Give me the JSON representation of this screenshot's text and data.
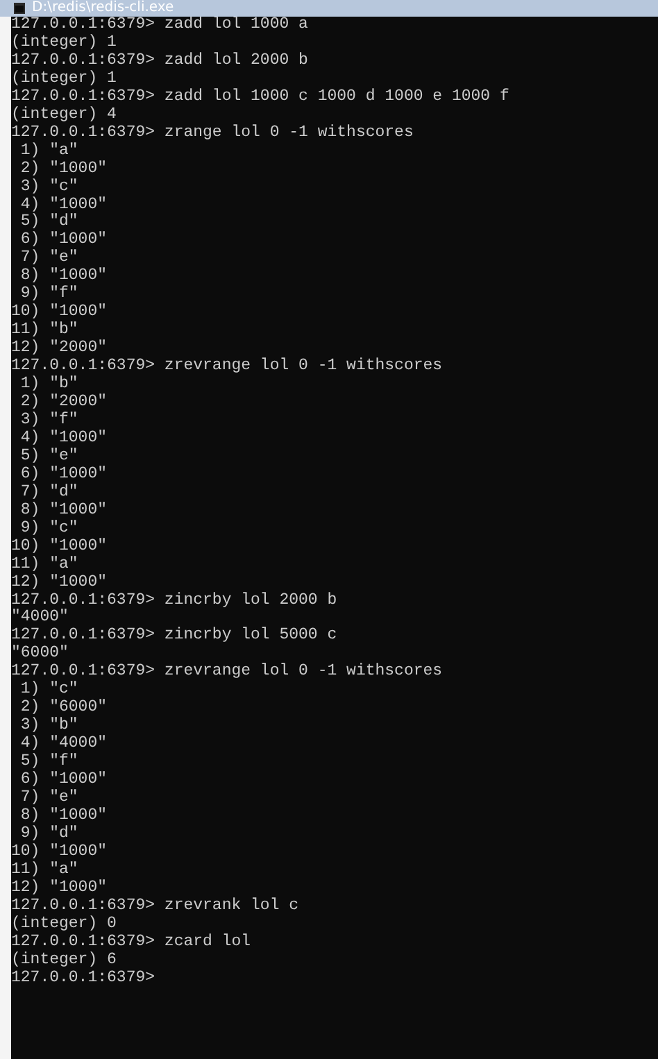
{
  "window": {
    "title": "D:\\redis\\redis-cli.exe"
  },
  "lines": [
    "127.0.0.1:6379> zadd lol 1000 a",
    "(integer) 1",
    "127.0.0.1:6379> zadd lol 2000 b",
    "(integer) 1",
    "127.0.0.1:6379> zadd lol 1000 c 1000 d 1000 e 1000 f",
    "(integer) 4",
    "127.0.0.1:6379> zrange lol 0 -1 withscores",
    " 1) \"a\"",
    " 2) \"1000\"",
    " 3) \"c\"",
    " 4) \"1000\"",
    " 5) \"d\"",
    " 6) \"1000\"",
    " 7) \"e\"",
    " 8) \"1000\"",
    " 9) \"f\"",
    "10) \"1000\"",
    "11) \"b\"",
    "12) \"2000\"",
    "127.0.0.1:6379> zrevrange lol 0 -1 withscores",
    " 1) \"b\"",
    " 2) \"2000\"",
    " 3) \"f\"",
    " 4) \"1000\"",
    " 5) \"e\"",
    " 6) \"1000\"",
    " 7) \"d\"",
    " 8) \"1000\"",
    " 9) \"c\"",
    "10) \"1000\"",
    "11) \"a\"",
    "12) \"1000\"",
    "127.0.0.1:6379> zincrby lol 2000 b",
    "\"4000\"",
    "127.0.0.1:6379> zincrby lol 5000 c",
    "\"6000\"",
    "127.0.0.1:6379> zrevrange lol 0 -1 withscores",
    " 1) \"c\"",
    " 2) \"6000\"",
    " 3) \"b\"",
    " 4) \"4000\"",
    " 5) \"f\"",
    " 6) \"1000\"",
    " 7) \"e\"",
    " 8) \"1000\"",
    " 9) \"d\"",
    "10) \"1000\"",
    "11) \"a\"",
    "12) \"1000\"",
    "127.0.0.1:6379> zrevrank lol c",
    "(integer) 0",
    "127.0.0.1:6379> zcard lol",
    "(integer) 6",
    "127.0.0.1:6379>"
  ]
}
